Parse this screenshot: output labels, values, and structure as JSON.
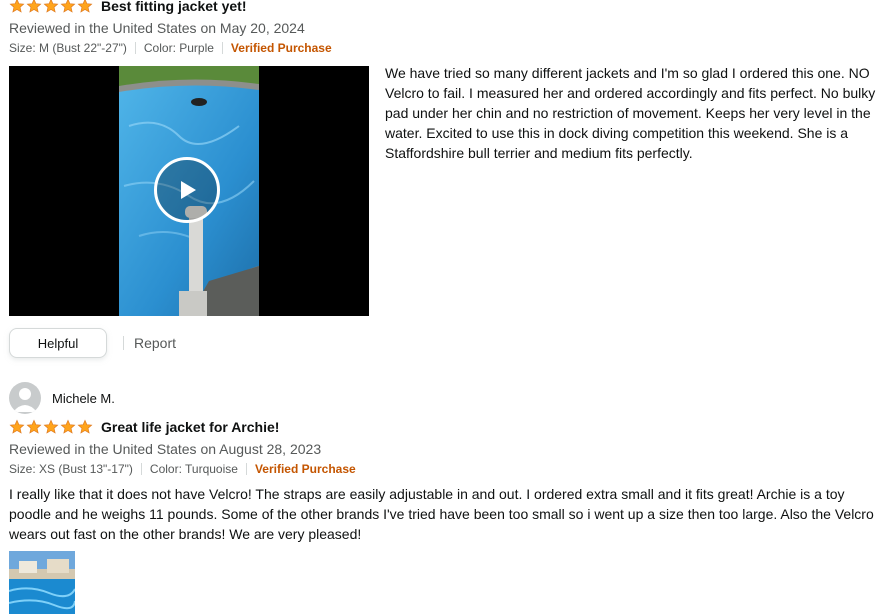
{
  "review1": {
    "rating": 5,
    "title": "Best fitting jacket yet!",
    "date": "Reviewed in the United States on May 20, 2024",
    "size": "Size: M (Bust 22\"-27\")",
    "color": "Color: Purple",
    "verified": "Verified Purchase",
    "body": "We have tried so many different jackets and I'm so glad I ordered this one. NO Velcro to fail. I measured her and ordered accordingly and fits perfect. No bulky pad under her chin and no restriction of movement. Keeps her very level in the water. Excited to use this in dock diving competition this weekend. She is a Staffordshire bull terrier and medium fits perfectly.",
    "helpful_label": "Helpful",
    "report_label": "Report"
  },
  "review2": {
    "reviewer": "Michele M.",
    "rating": 5,
    "title": "Great life jacket for Archie!",
    "date": "Reviewed in the United States on August 28, 2023",
    "size": "Size: XS (Bust 13\"-17\")",
    "color": "Color: Turquoise",
    "verified": "Verified Purchase",
    "body": "I really like that it does not have Velcro! The straps are easily adjustable in and out. I ordered extra small and it fits great! Archie is a toy poodle and he weighs 11 pounds. Some of the other brands I've tried have been too small so i went up a size then too large. Also the Velcro wears out fast on the other brands! We are very pleased!"
  },
  "colors": {
    "star": "#ffa41c",
    "star_border": "#de7921",
    "verified": "#c45500",
    "muted_text": "#565959"
  },
  "icons": {
    "star": "star-icon",
    "play": "play-icon",
    "avatar": "default-avatar-icon"
  }
}
